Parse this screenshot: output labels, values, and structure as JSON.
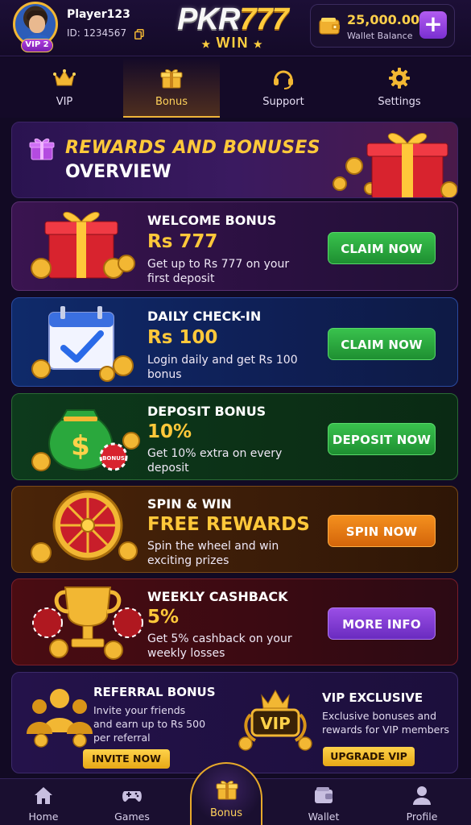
{
  "header": {
    "player_name": "Player123",
    "player_id": "ID: 1234567",
    "vip_badge": "VIP 2",
    "logo_main_prefix": "PKR",
    "logo_main_number": "777",
    "logo_sub": "WIN",
    "wallet_amount": "25,000.00",
    "wallet_label": "Wallet Balance",
    "add_label": "+"
  },
  "top_nav": [
    {
      "label": "VIP",
      "icon": "crown-icon"
    },
    {
      "label": "Bonus",
      "icon": "gift-icon",
      "active": true
    },
    {
      "label": "Support",
      "icon": "headset-icon"
    },
    {
      "label": "Settings",
      "icon": "gear-icon"
    }
  ],
  "banner": {
    "title": "REWARDS AND BONUSES",
    "subtitle": "OVERVIEW"
  },
  "cards": {
    "welcome": {
      "title": "WELCOME BONUS",
      "amount": "Rs 777",
      "desc": "Get up to Rs 777 on your first deposit",
      "button": "CLAIM NOW"
    },
    "daily": {
      "title": "DAILY CHECK-IN",
      "amount": "Rs 100",
      "desc": "Login daily and get Rs 100 bonus",
      "button": "CLAIM NOW"
    },
    "deposit": {
      "title": "DEPOSIT BONUS",
      "amount": "10%",
      "desc": "Get 10% extra on every deposit",
      "button": "DEPOSIT NOW",
      "chip_text": "BONUS"
    },
    "spin": {
      "title": "SPIN & WIN",
      "amount": "FREE REWARDS",
      "desc": "Spin the wheel and win exciting prizes",
      "button": "SPIN NOW"
    },
    "cashback": {
      "title": "WEEKLY CASHBACK",
      "amount": "5%",
      "desc": "Get 5% cashback on your weekly losses",
      "button": "MORE INFO"
    }
  },
  "referral": {
    "title": "REFERRAL BONUS",
    "desc": "Invite your friends and earn up to Rs 500 per referral",
    "button": "INVITE NOW"
  },
  "vip_exclusive": {
    "title": "VIP EXCLUSIVE",
    "desc": "Exclusive bonuses and rewards for VIP members",
    "button": "UPGRADE VIP",
    "emblem_text": "VIP"
  },
  "bottom_nav": [
    {
      "label": "Home",
      "icon": "home-icon"
    },
    {
      "label": "Games",
      "icon": "gamepad-icon"
    },
    {
      "label": "Bonus",
      "icon": "gift-icon",
      "active": true
    },
    {
      "label": "Wallet",
      "icon": "wallet-icon"
    },
    {
      "label": "Profile",
      "icon": "user-icon"
    }
  ],
  "colors": {
    "accent_gold": "#ffc83a",
    "background": "#120a24",
    "green_button": "#2aa83d",
    "orange_button": "#e8780f",
    "purple_button": "#8540d8"
  }
}
